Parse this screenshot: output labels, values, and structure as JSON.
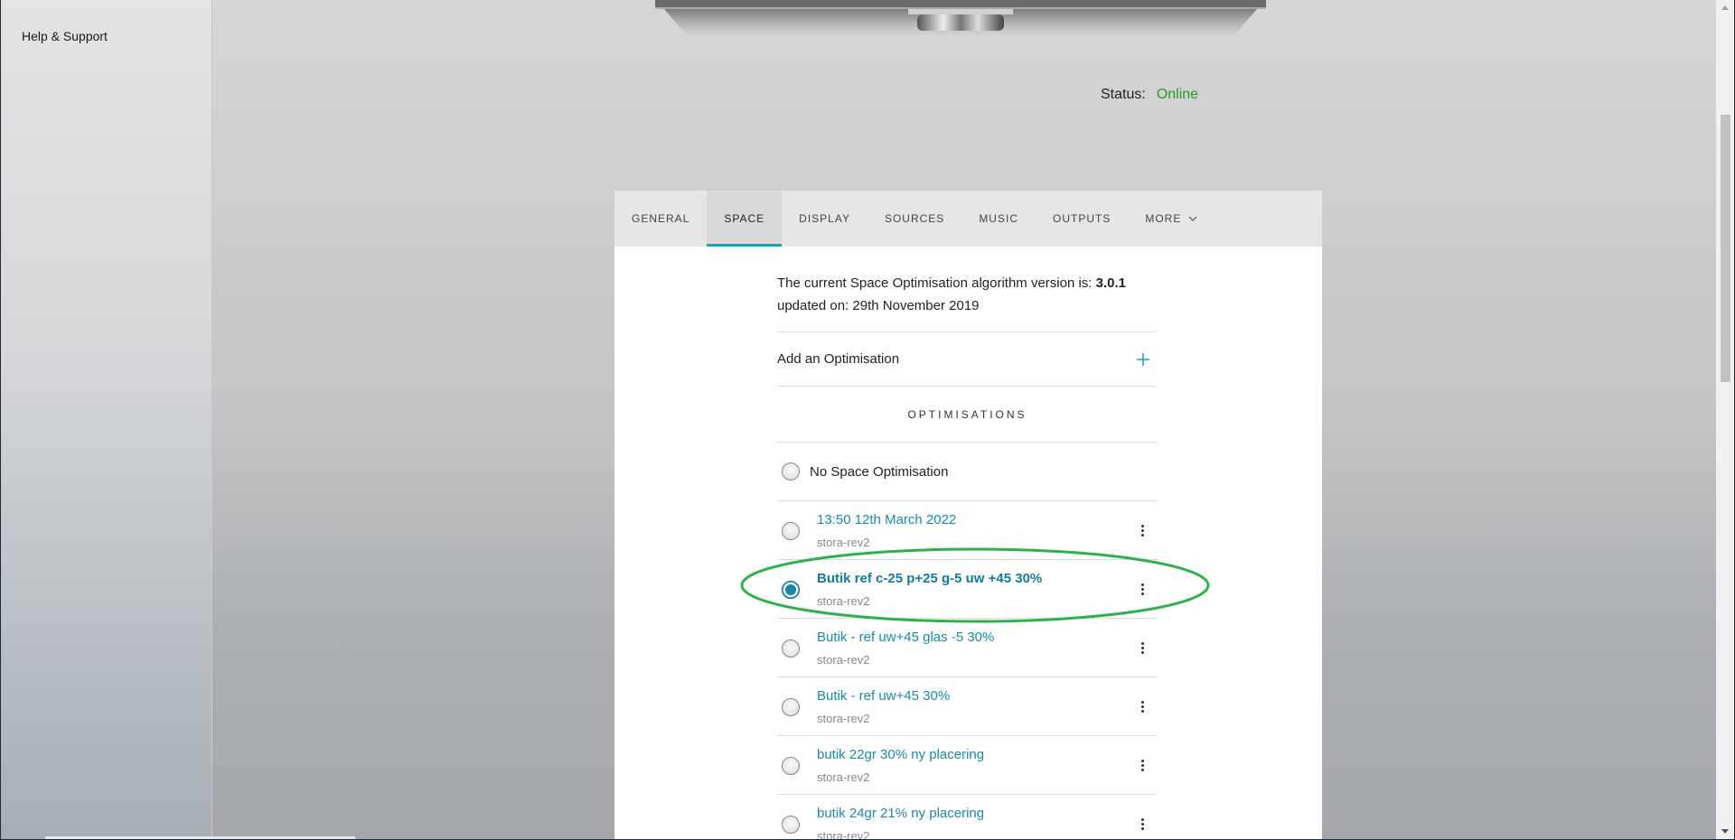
{
  "sidebar": {
    "items": [
      {
        "label": "Help & Support"
      }
    ]
  },
  "status": {
    "label": "Status:",
    "value": "Online",
    "value_color": "#1fa01f"
  },
  "tabs": [
    {
      "label": "GENERAL",
      "active": false
    },
    {
      "label": "SPACE",
      "active": true
    },
    {
      "label": "DISPLAY",
      "active": false
    },
    {
      "label": "SOURCES",
      "active": false
    },
    {
      "label": "MUSIC",
      "active": false
    },
    {
      "label": "OUTPUTS",
      "active": false
    },
    {
      "label": "MORE",
      "active": false,
      "icon": "chevron-down-icon"
    }
  ],
  "space": {
    "algo_prefix": "The current Space Optimisation algorithm version is: ",
    "algo_version": "3.0.1",
    "algo_updated": "updated on: 29th November 2019",
    "add_label": "Add an Optimisation",
    "add_icon": "plus-icon",
    "section_heading": "OPTIMISATIONS",
    "no_optimisation_label": "No Space Optimisation",
    "optimisations": [
      {
        "name": "13:50 12th March 2022",
        "room": "stora-rev2",
        "selected": false
      },
      {
        "name": "Butik ref c-25 p+25 g-5 uw +45 30%",
        "room": "stora-rev2",
        "selected": true
      },
      {
        "name": "Butik - ref uw+45 glas -5 30%",
        "room": "stora-rev2",
        "selected": false
      },
      {
        "name": "Butik - ref uw+45 30%",
        "room": "stora-rev2",
        "selected": false
      },
      {
        "name": "butik 22gr 30% ny placering",
        "room": "stora-rev2",
        "selected": false
      },
      {
        "name": "butik 24gr 21% ny placering",
        "room": "stora-rev2",
        "selected": false
      }
    ]
  },
  "colors": {
    "accent": "#1aa1b8",
    "link": "#1a8aa8",
    "highlight_ellipse": "#2db14b"
  }
}
